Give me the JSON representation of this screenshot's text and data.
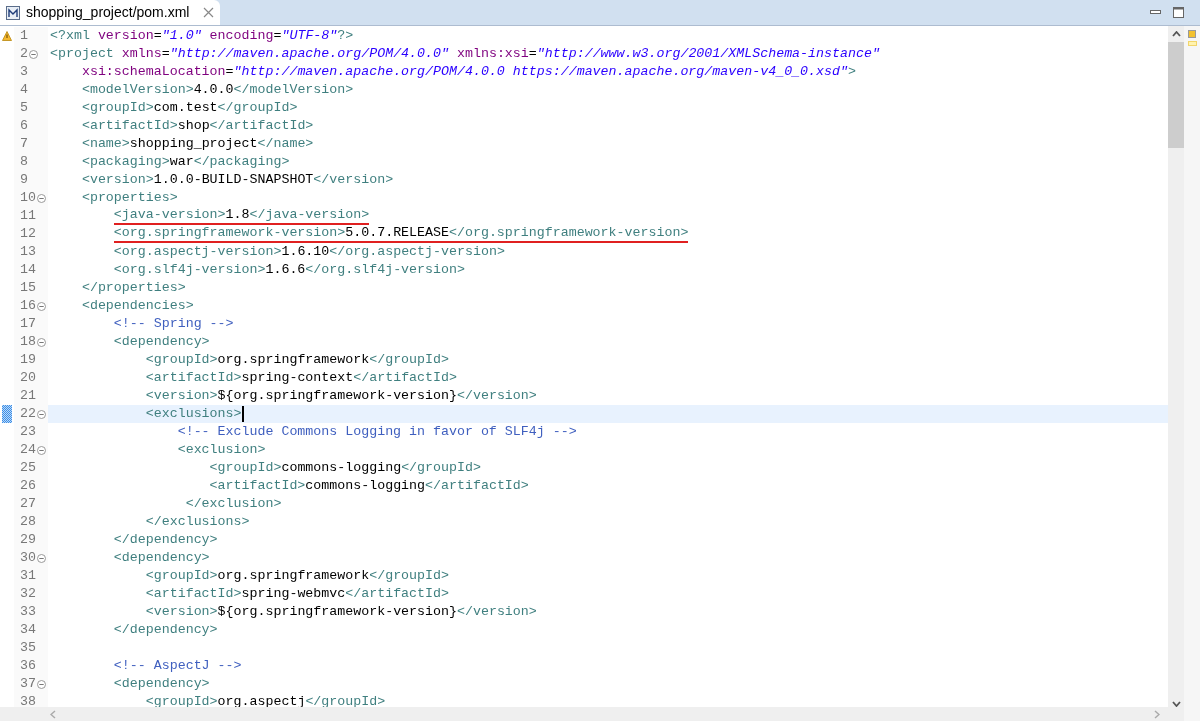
{
  "tab": {
    "title": "shopping_project/pom.xml",
    "selected": true
  },
  "lines": [
    {
      "number": "1",
      "tokens": [
        {
          "kind": "tag",
          "text": "<?xml"
        },
        {
          "kind": "attr",
          "text": " version"
        },
        {
          "kind": "text",
          "text": "="
        },
        {
          "kind": "value",
          "text": "\"1.0\""
        },
        {
          "kind": "attr",
          "text": " encoding"
        },
        {
          "kind": "text",
          "text": "="
        },
        {
          "kind": "value",
          "text": "\"UTF-8\""
        },
        {
          "kind": "tag",
          "text": "?>"
        }
      ],
      "marker": {
        "kind": "warning"
      }
    },
    {
      "number": "2",
      "tokens": [
        {
          "kind": "tag",
          "text": "<project"
        },
        {
          "kind": "attr",
          "text": " xmlns"
        },
        {
          "kind": "text",
          "text": "="
        },
        {
          "kind": "value",
          "text": "\"http://maven.apache.org/POM/4.0.0\""
        },
        {
          "kind": "attr",
          "text": " xmlns:xsi"
        },
        {
          "kind": "text",
          "text": "="
        },
        {
          "kind": "value",
          "text": "\"http://www.w3.org/2001/XMLSchema-instance\""
        }
      ],
      "foldable": true
    },
    {
      "number": "3",
      "tokens": [
        {
          "kind": "attr",
          "text": "    xsi:schemaLocation"
        },
        {
          "kind": "text",
          "text": "="
        },
        {
          "kind": "value",
          "text": "\"http://maven.apache.org/POM/4.0.0 https://maven.apache.org/maven-v4_0_0.xsd\""
        },
        {
          "kind": "tag",
          "text": ">"
        }
      ]
    },
    {
      "number": "4",
      "tokens": [
        {
          "kind": "tag",
          "text": "    <modelVersion>"
        },
        {
          "kind": "text",
          "text": "4.0.0"
        },
        {
          "kind": "tag",
          "text": "</modelVersion>"
        }
      ]
    },
    {
      "number": "5",
      "tokens": [
        {
          "kind": "tag",
          "text": "    <groupId>"
        },
        {
          "kind": "text",
          "text": "com.test"
        },
        {
          "kind": "tag",
          "text": "</groupId>"
        }
      ]
    },
    {
      "number": "6",
      "tokens": [
        {
          "kind": "tag",
          "text": "    <artifactId>"
        },
        {
          "kind": "text",
          "text": "shop"
        },
        {
          "kind": "tag",
          "text": "</artifactId>"
        }
      ]
    },
    {
      "number": "7",
      "tokens": [
        {
          "kind": "tag",
          "text": "    <name>"
        },
        {
          "kind": "text",
          "text": "shopping_project"
        },
        {
          "kind": "tag",
          "text": "</name>"
        }
      ]
    },
    {
      "number": "8",
      "tokens": [
        {
          "kind": "tag",
          "text": "    <packaging>"
        },
        {
          "kind": "text",
          "text": "war"
        },
        {
          "kind": "tag",
          "text": "</packaging>"
        }
      ]
    },
    {
      "number": "9",
      "tokens": [
        {
          "kind": "tag",
          "text": "    <version>"
        },
        {
          "kind": "text",
          "text": "1.0.0-BUILD-SNAPSHOT"
        },
        {
          "kind": "tag",
          "text": "</version>"
        }
      ]
    },
    {
      "number": "10",
      "tokens": [
        {
          "kind": "tag",
          "text": "    <properties>"
        }
      ],
      "foldable": true
    },
    {
      "number": "11",
      "tokens": [
        {
          "kind": "tag",
          "text": "        <java-version>"
        },
        {
          "kind": "text",
          "text": "1.8"
        },
        {
          "kind": "tag",
          "text": "</java-version>"
        }
      ],
      "underline": true
    },
    {
      "number": "12",
      "tokens": [
        {
          "kind": "tag",
          "text": "        <org.springframework-version>"
        },
        {
          "kind": "text",
          "text": "5.0.7.RELEASE"
        },
        {
          "kind": "tag",
          "text": "</org.springframework-version>"
        }
      ],
      "underline": true
    },
    {
      "number": "13",
      "tokens": [
        {
          "kind": "tag",
          "text": "        <org.aspectj-version>"
        },
        {
          "kind": "text",
          "text": "1.6.10"
        },
        {
          "kind": "tag",
          "text": "</org.aspectj-version>"
        }
      ]
    },
    {
      "number": "14",
      "tokens": [
        {
          "kind": "tag",
          "text": "        <org.slf4j-version>"
        },
        {
          "kind": "text",
          "text": "1.6.6"
        },
        {
          "kind": "tag",
          "text": "</org.slf4j-version>"
        }
      ]
    },
    {
      "number": "15",
      "tokens": [
        {
          "kind": "tag",
          "text": "    </properties>"
        }
      ]
    },
    {
      "number": "16",
      "tokens": [
        {
          "kind": "tag",
          "text": "    <dependencies>"
        }
      ],
      "foldable": true
    },
    {
      "number": "17",
      "tokens": [
        {
          "kind": "comment",
          "text": "        <!-- Spring -->"
        }
      ]
    },
    {
      "number": "18",
      "tokens": [
        {
          "kind": "tag",
          "text": "        <dependency>"
        }
      ],
      "foldable": true
    },
    {
      "number": "19",
      "tokens": [
        {
          "kind": "tag",
          "text": "            <groupId>"
        },
        {
          "kind": "text",
          "text": "org.springframework"
        },
        {
          "kind": "tag",
          "text": "</groupId>"
        }
      ]
    },
    {
      "number": "20",
      "tokens": [
        {
          "kind": "tag",
          "text": "            <artifactId>"
        },
        {
          "kind": "text",
          "text": "spring-context"
        },
        {
          "kind": "tag",
          "text": "</artifactId>"
        }
      ]
    },
    {
      "number": "21",
      "tokens": [
        {
          "kind": "tag",
          "text": "            <version>"
        },
        {
          "kind": "text",
          "text": "${org.springframework-version}"
        },
        {
          "kind": "tag",
          "text": "</version>"
        }
      ]
    },
    {
      "number": "22",
      "tokens": [
        {
          "kind": "tag",
          "text": "            <exclusions>"
        }
      ],
      "foldable": true,
      "current": true,
      "marker": {
        "kind": "changed"
      }
    },
    {
      "number": "23",
      "tokens": [
        {
          "kind": "comment",
          "text": "                <!-- Exclude Commons Logging in favor of SLF4j -->"
        }
      ]
    },
    {
      "number": "24",
      "tokens": [
        {
          "kind": "tag",
          "text": "                <exclusion>"
        }
      ],
      "foldable": true
    },
    {
      "number": "25",
      "tokens": [
        {
          "kind": "tag",
          "text": "                    <groupId>"
        },
        {
          "kind": "text",
          "text": "commons-logging"
        },
        {
          "kind": "tag",
          "text": "</groupId>"
        }
      ]
    },
    {
      "number": "26",
      "tokens": [
        {
          "kind": "tag",
          "text": "                    <artifactId>"
        },
        {
          "kind": "text",
          "text": "commons-logging"
        },
        {
          "kind": "tag",
          "text": "</artifactId>"
        }
      ]
    },
    {
      "number": "27",
      "tokens": [
        {
          "kind": "tag",
          "text": "                 </exclusion>"
        }
      ]
    },
    {
      "number": "28",
      "tokens": [
        {
          "kind": "tag",
          "text": "            </exclusions>"
        }
      ]
    },
    {
      "number": "29",
      "tokens": [
        {
          "kind": "tag",
          "text": "        </dependency>"
        }
      ]
    },
    {
      "number": "30",
      "tokens": [
        {
          "kind": "tag",
          "text": "        <dependency>"
        }
      ],
      "foldable": true
    },
    {
      "number": "31",
      "tokens": [
        {
          "kind": "tag",
          "text": "            <groupId>"
        },
        {
          "kind": "text",
          "text": "org.springframework"
        },
        {
          "kind": "tag",
          "text": "</groupId>"
        }
      ]
    },
    {
      "number": "32",
      "tokens": [
        {
          "kind": "tag",
          "text": "            <artifactId>"
        },
        {
          "kind": "text",
          "text": "spring-webmvc"
        },
        {
          "kind": "tag",
          "text": "</artifactId>"
        }
      ]
    },
    {
      "number": "33",
      "tokens": [
        {
          "kind": "tag",
          "text": "            <version>"
        },
        {
          "kind": "text",
          "text": "${org.springframework-version}"
        },
        {
          "kind": "tag",
          "text": "</version>"
        }
      ]
    },
    {
      "number": "34",
      "tokens": [
        {
          "kind": "tag",
          "text": "        </dependency>"
        }
      ]
    },
    {
      "number": "35"
    },
    {
      "number": "36",
      "tokens": [
        {
          "kind": "comment",
          "text": "        <!-- AspectJ -->"
        }
      ]
    },
    {
      "number": "37",
      "tokens": [
        {
          "kind": "tag",
          "text": "        <dependency>"
        }
      ],
      "foldable": true
    },
    {
      "number": "38",
      "tokens": [
        {
          "kind": "tag",
          "text": "            <groupId>"
        },
        {
          "kind": "text",
          "text": "org.aspectj"
        },
        {
          "kind": "tag",
          "text": "</groupId>"
        }
      ]
    }
  ]
}
